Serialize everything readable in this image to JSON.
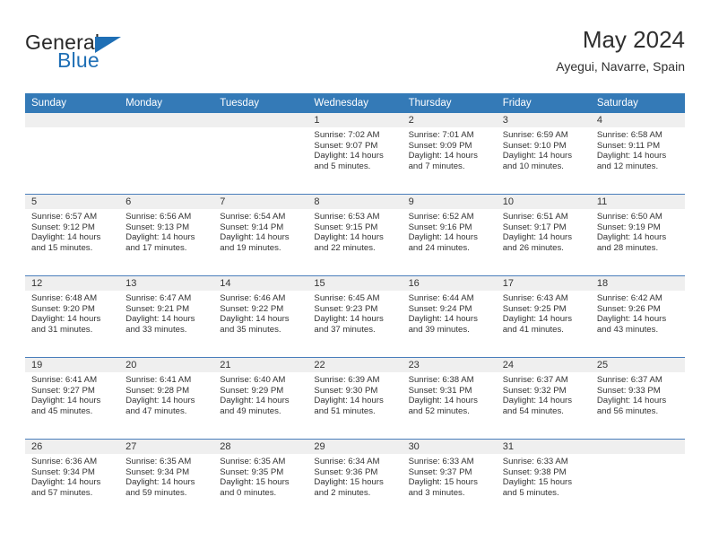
{
  "brand": {
    "name_top": "General",
    "name_bottom": "Blue",
    "accent_color": "#1f6fb5",
    "triangle_icon": "brand-triangle-icon"
  },
  "header": {
    "title": "May 2024",
    "subtitle": "Ayegui, Navarre, Spain"
  },
  "theme": {
    "header_blue": "#347ab7",
    "row_divider_blue": "#4a7ebb",
    "daynum_band_gray": "#efefef",
    "text_color": "#333333"
  },
  "calendar": {
    "weekday_headers": [
      "Sunday",
      "Monday",
      "Tuesday",
      "Wednesday",
      "Thursday",
      "Friday",
      "Saturday"
    ],
    "weeks": [
      [
        {
          "day": "",
          "blank": true,
          "sunrise": "",
          "sunset": "",
          "daylight_1": "",
          "daylight_2": ""
        },
        {
          "day": "",
          "blank": true,
          "sunrise": "",
          "sunset": "",
          "daylight_1": "",
          "daylight_2": ""
        },
        {
          "day": "",
          "blank": true,
          "sunrise": "",
          "sunset": "",
          "daylight_1": "",
          "daylight_2": ""
        },
        {
          "day": "1",
          "sunrise": "Sunrise: 7:02 AM",
          "sunset": "Sunset: 9:07 PM",
          "daylight_1": "Daylight: 14 hours",
          "daylight_2": "and 5 minutes."
        },
        {
          "day": "2",
          "sunrise": "Sunrise: 7:01 AM",
          "sunset": "Sunset: 9:09 PM",
          "daylight_1": "Daylight: 14 hours",
          "daylight_2": "and 7 minutes."
        },
        {
          "day": "3",
          "sunrise": "Sunrise: 6:59 AM",
          "sunset": "Sunset: 9:10 PM",
          "daylight_1": "Daylight: 14 hours",
          "daylight_2": "and 10 minutes."
        },
        {
          "day": "4",
          "sunrise": "Sunrise: 6:58 AM",
          "sunset": "Sunset: 9:11 PM",
          "daylight_1": "Daylight: 14 hours",
          "daylight_2": "and 12 minutes."
        }
      ],
      [
        {
          "day": "5",
          "sunrise": "Sunrise: 6:57 AM",
          "sunset": "Sunset: 9:12 PM",
          "daylight_1": "Daylight: 14 hours",
          "daylight_2": "and 15 minutes."
        },
        {
          "day": "6",
          "sunrise": "Sunrise: 6:56 AM",
          "sunset": "Sunset: 9:13 PM",
          "daylight_1": "Daylight: 14 hours",
          "daylight_2": "and 17 minutes."
        },
        {
          "day": "7",
          "sunrise": "Sunrise: 6:54 AM",
          "sunset": "Sunset: 9:14 PM",
          "daylight_1": "Daylight: 14 hours",
          "daylight_2": "and 19 minutes."
        },
        {
          "day": "8",
          "sunrise": "Sunrise: 6:53 AM",
          "sunset": "Sunset: 9:15 PM",
          "daylight_1": "Daylight: 14 hours",
          "daylight_2": "and 22 minutes."
        },
        {
          "day": "9",
          "sunrise": "Sunrise: 6:52 AM",
          "sunset": "Sunset: 9:16 PM",
          "daylight_1": "Daylight: 14 hours",
          "daylight_2": "and 24 minutes."
        },
        {
          "day": "10",
          "sunrise": "Sunrise: 6:51 AM",
          "sunset": "Sunset: 9:17 PM",
          "daylight_1": "Daylight: 14 hours",
          "daylight_2": "and 26 minutes."
        },
        {
          "day": "11",
          "sunrise": "Sunrise: 6:50 AM",
          "sunset": "Sunset: 9:19 PM",
          "daylight_1": "Daylight: 14 hours",
          "daylight_2": "and 28 minutes."
        }
      ],
      [
        {
          "day": "12",
          "sunrise": "Sunrise: 6:48 AM",
          "sunset": "Sunset: 9:20 PM",
          "daylight_1": "Daylight: 14 hours",
          "daylight_2": "and 31 minutes."
        },
        {
          "day": "13",
          "sunrise": "Sunrise: 6:47 AM",
          "sunset": "Sunset: 9:21 PM",
          "daylight_1": "Daylight: 14 hours",
          "daylight_2": "and 33 minutes."
        },
        {
          "day": "14",
          "sunrise": "Sunrise: 6:46 AM",
          "sunset": "Sunset: 9:22 PM",
          "daylight_1": "Daylight: 14 hours",
          "daylight_2": "and 35 minutes."
        },
        {
          "day": "15",
          "sunrise": "Sunrise: 6:45 AM",
          "sunset": "Sunset: 9:23 PM",
          "daylight_1": "Daylight: 14 hours",
          "daylight_2": "and 37 minutes."
        },
        {
          "day": "16",
          "sunrise": "Sunrise: 6:44 AM",
          "sunset": "Sunset: 9:24 PM",
          "daylight_1": "Daylight: 14 hours",
          "daylight_2": "and 39 minutes."
        },
        {
          "day": "17",
          "sunrise": "Sunrise: 6:43 AM",
          "sunset": "Sunset: 9:25 PM",
          "daylight_1": "Daylight: 14 hours",
          "daylight_2": "and 41 minutes."
        },
        {
          "day": "18",
          "sunrise": "Sunrise: 6:42 AM",
          "sunset": "Sunset: 9:26 PM",
          "daylight_1": "Daylight: 14 hours",
          "daylight_2": "and 43 minutes."
        }
      ],
      [
        {
          "day": "19",
          "sunrise": "Sunrise: 6:41 AM",
          "sunset": "Sunset: 9:27 PM",
          "daylight_1": "Daylight: 14 hours",
          "daylight_2": "and 45 minutes."
        },
        {
          "day": "20",
          "sunrise": "Sunrise: 6:41 AM",
          "sunset": "Sunset: 9:28 PM",
          "daylight_1": "Daylight: 14 hours",
          "daylight_2": "and 47 minutes."
        },
        {
          "day": "21",
          "sunrise": "Sunrise: 6:40 AM",
          "sunset": "Sunset: 9:29 PM",
          "daylight_1": "Daylight: 14 hours",
          "daylight_2": "and 49 minutes."
        },
        {
          "day": "22",
          "sunrise": "Sunrise: 6:39 AM",
          "sunset": "Sunset: 9:30 PM",
          "daylight_1": "Daylight: 14 hours",
          "daylight_2": "and 51 minutes."
        },
        {
          "day": "23",
          "sunrise": "Sunrise: 6:38 AM",
          "sunset": "Sunset: 9:31 PM",
          "daylight_1": "Daylight: 14 hours",
          "daylight_2": "and 52 minutes."
        },
        {
          "day": "24",
          "sunrise": "Sunrise: 6:37 AM",
          "sunset": "Sunset: 9:32 PM",
          "daylight_1": "Daylight: 14 hours",
          "daylight_2": "and 54 minutes."
        },
        {
          "day": "25",
          "sunrise": "Sunrise: 6:37 AM",
          "sunset": "Sunset: 9:33 PM",
          "daylight_1": "Daylight: 14 hours",
          "daylight_2": "and 56 minutes."
        }
      ],
      [
        {
          "day": "26",
          "sunrise": "Sunrise: 6:36 AM",
          "sunset": "Sunset: 9:34 PM",
          "daylight_1": "Daylight: 14 hours",
          "daylight_2": "and 57 minutes."
        },
        {
          "day": "27",
          "sunrise": "Sunrise: 6:35 AM",
          "sunset": "Sunset: 9:34 PM",
          "daylight_1": "Daylight: 14 hours",
          "daylight_2": "and 59 minutes."
        },
        {
          "day": "28",
          "sunrise": "Sunrise: 6:35 AM",
          "sunset": "Sunset: 9:35 PM",
          "daylight_1": "Daylight: 15 hours",
          "daylight_2": "and 0 minutes."
        },
        {
          "day": "29",
          "sunrise": "Sunrise: 6:34 AM",
          "sunset": "Sunset: 9:36 PM",
          "daylight_1": "Daylight: 15 hours",
          "daylight_2": "and 2 minutes."
        },
        {
          "day": "30",
          "sunrise": "Sunrise: 6:33 AM",
          "sunset": "Sunset: 9:37 PM",
          "daylight_1": "Daylight: 15 hours",
          "daylight_2": "and 3 minutes."
        },
        {
          "day": "31",
          "sunrise": "Sunrise: 6:33 AM",
          "sunset": "Sunset: 9:38 PM",
          "daylight_1": "Daylight: 15 hours",
          "daylight_2": "and 5 minutes."
        },
        {
          "day": "",
          "blank": true,
          "sunrise": "",
          "sunset": "",
          "daylight_1": "",
          "daylight_2": ""
        }
      ]
    ]
  }
}
